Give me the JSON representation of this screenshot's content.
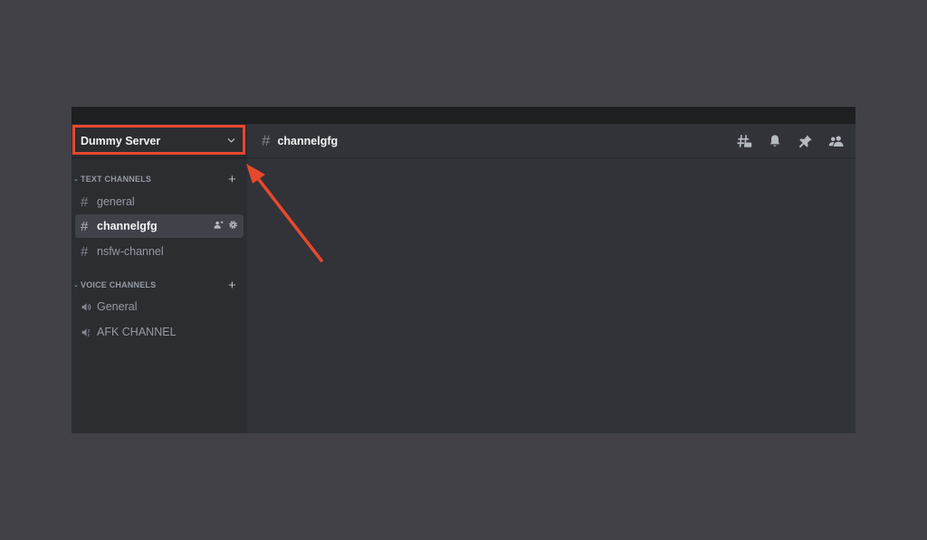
{
  "server": {
    "name": "Dummy Server"
  },
  "categories": {
    "text": {
      "label": "TEXT CHANNELS"
    },
    "voice": {
      "label": "VOICE CHANNELS"
    }
  },
  "text_channels": [
    {
      "name": "general",
      "icon": "hash-icon"
    },
    {
      "name": "channelgfg",
      "icon": "hash-icon",
      "selected": true
    },
    {
      "name": "nsfw-channel",
      "icon": "hash-icon"
    }
  ],
  "voice_channels": [
    {
      "name": "General",
      "icon": "speaker-icon"
    },
    {
      "name": "AFK CHANNEL",
      "icon": "speaker-afk-icon"
    }
  ],
  "header": {
    "channel_name": "channelgfg",
    "tools": [
      "threads-icon",
      "bell-icon",
      "pin-icon",
      "members-icon"
    ]
  },
  "annotation": {
    "color": "#e8482d"
  },
  "colors": {
    "background": "#414147",
    "sidebar": "#2b2d31",
    "main": "#313338",
    "selected": "#404249"
  }
}
